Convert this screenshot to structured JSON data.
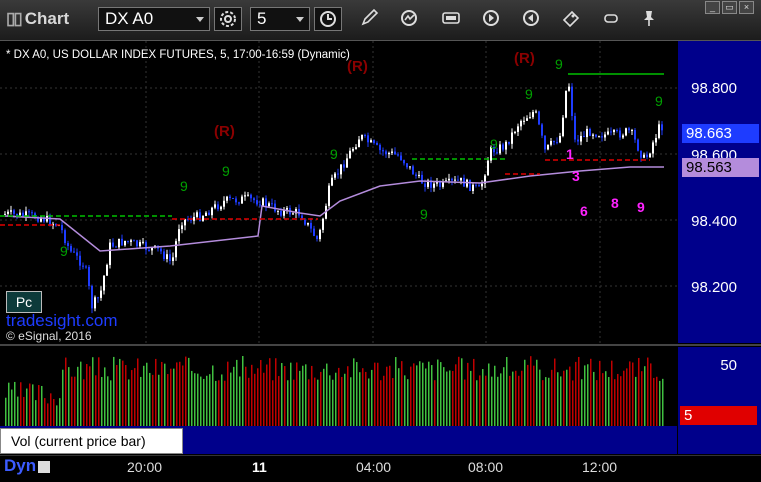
{
  "window": {
    "title": "Chart",
    "symbol": "DX A0",
    "interval": "5",
    "min_label": "_",
    "restore_label": "▭",
    "close_label": "×"
  },
  "toolbar": {
    "icons": [
      "settings-gear-icon",
      "clock-icon",
      "pencil-icon",
      "refresh-icon",
      "edit-icon",
      "play-icon",
      "tag-icon",
      "pin-icon"
    ]
  },
  "chart": {
    "caption": "* DX A0, US DOLLAR INDEX FUTURES, 5, 17:00-16:59 (Dynamic)",
    "watermark": "tradesight.com",
    "copyright": "© eSignal, 2016",
    "pc_label": "Pc",
    "price_axis": [
      "98.800",
      "98.600",
      "98.400",
      "98.200"
    ],
    "last_price": "98.663",
    "ma_price": "98.563",
    "colors": {
      "axis_bg": "#00008b",
      "up_bar": "#ffffff",
      "down_bar": "#1e3cff",
      "ma_line": "#b48cdc",
      "resistance": "#00c000",
      "support": "#e00000",
      "count_green": "#00a000",
      "count_magenta": "#ff22ff",
      "r_marker": "#8b0000"
    },
    "r_markers": [
      "(R)",
      "(R)",
      "(R)"
    ],
    "magenta_counts": [
      "1",
      "3",
      "6",
      "8",
      "9"
    ]
  },
  "volume": {
    "label": "Vol (current price bar)",
    "close": "×",
    "axis_top": "50",
    "axis_value": "5"
  },
  "timeline": {
    "mode": "Dyn",
    "ticks": [
      "20:00",
      "11",
      "04:00",
      "08:00",
      "12:00"
    ]
  }
}
